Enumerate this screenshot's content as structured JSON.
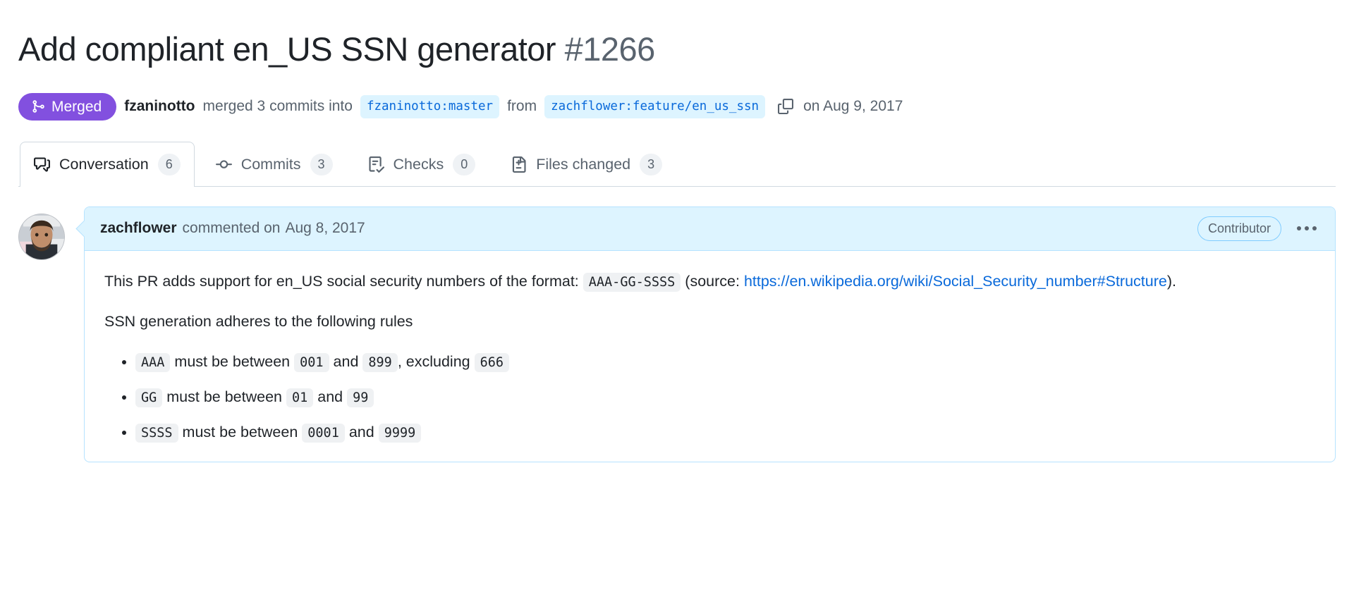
{
  "pr": {
    "title": "Add compliant en_US SSN generator",
    "number": "#1266"
  },
  "status": {
    "state_label": "Merged",
    "state_color": "#8250df",
    "actor": "fzaninotto",
    "merged_text": "merged 3 commits into",
    "base_branch": "fzaninotto:master",
    "from_text": "from",
    "head_branch": "zachflower:feature/en_us_ssn",
    "copy_icon": "copy-icon",
    "merged_date": "on Aug 9, 2017"
  },
  "tabs": [
    {
      "label": "Conversation",
      "count": "6",
      "icon": "comment-discussion-icon",
      "active": true
    },
    {
      "label": "Commits",
      "count": "3",
      "icon": "git-commit-icon",
      "active": false
    },
    {
      "label": "Checks",
      "count": "0",
      "icon": "checklist-icon",
      "active": false
    },
    {
      "label": "Files changed",
      "count": "3",
      "icon": "file-diff-icon",
      "active": false
    }
  ],
  "comment": {
    "avatar_name": "zachflower-avatar",
    "author": "zachflower",
    "action": "commented on",
    "date": "Aug 8, 2017",
    "association": "Contributor",
    "menu_icon": "kebab-horizontal-icon",
    "body": {
      "p1_before_code": "This PR adds support for en_US social security numbers of the format:",
      "p1_code": "AAA-GG-SSSS",
      "p1_after_code": "(source:",
      "p1_link": "https://en.wikipedia.org/wiki/Social_Security_number#Structure",
      "p1_tail": ").",
      "p2": "SSN generation adheres to the following rules",
      "rules": [
        {
          "code1": "AAA",
          "mid": "must be between",
          "code2": "001",
          "and": "and",
          "code3": "899",
          "tail": ", excluding",
          "code4": "666"
        },
        {
          "code1": "GG",
          "mid": "must be between",
          "code2": "01",
          "and": "and",
          "code3": "99",
          "tail": "",
          "code4": ""
        },
        {
          "code1": "SSSS",
          "mid": "must be between",
          "code2": "0001",
          "and": "and",
          "code3": "9999",
          "tail": "",
          "code4": ""
        }
      ]
    }
  }
}
